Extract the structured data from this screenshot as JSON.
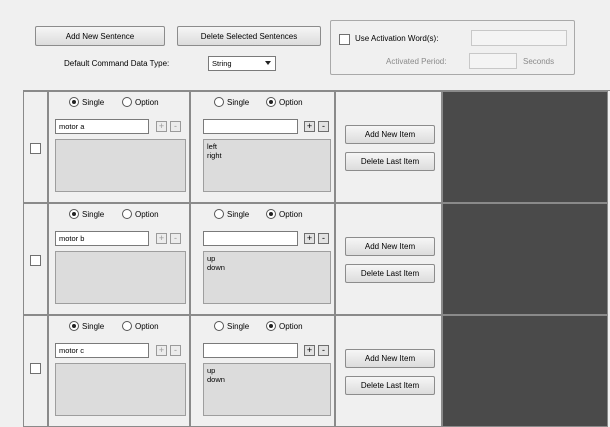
{
  "toolbar": {
    "add_sentence": "Add New Sentence",
    "delete_sentences": "Delete Selected Sentences",
    "default_type_label": "Default Command Data Type:",
    "default_type_value": "String"
  },
  "activation": {
    "checkbox_label": "Use Activation Word(s):",
    "period_label": "Activated Period:",
    "seconds_label": "Seconds"
  },
  "rows": [
    {
      "left": {
        "single": "Single",
        "option": "Option",
        "selected": "single",
        "value": "motor a",
        "items": []
      },
      "right": {
        "single": "Single",
        "option": "Option",
        "selected": "option",
        "value": "",
        "items": [
          "left",
          "right"
        ]
      },
      "add_item": "Add New Item",
      "delete_item": "Delete Last Item"
    },
    {
      "left": {
        "single": "Single",
        "option": "Option",
        "selected": "single",
        "value": "motor b",
        "items": []
      },
      "right": {
        "single": "Single",
        "option": "Option",
        "selected": "option",
        "value": "",
        "items": [
          "up",
          "down"
        ]
      },
      "add_item": "Add New Item",
      "delete_item": "Delete Last Item"
    },
    {
      "left": {
        "single": "Single",
        "option": "Option",
        "selected": "single",
        "value": "motor c",
        "items": []
      },
      "right": {
        "single": "Single",
        "option": "Option",
        "selected": "option",
        "value": "",
        "items": [
          "up",
          "down"
        ]
      },
      "add_item": "Add New Item",
      "delete_item": "Delete Last Item"
    }
  ],
  "glyphs": {
    "plus": "+",
    "minus": "-"
  }
}
